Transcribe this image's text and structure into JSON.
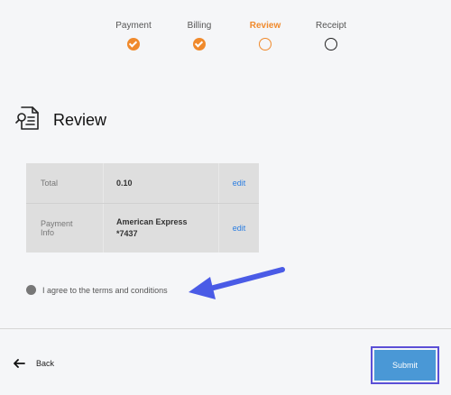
{
  "steps": [
    {
      "label": "Payment",
      "state": "done"
    },
    {
      "label": "Billing",
      "state": "done"
    },
    {
      "label": "Review",
      "state": "current"
    },
    {
      "label": "Receipt",
      "state": "todo"
    }
  ],
  "accent_color": "#f08a2c",
  "link_color": "#2a7de1",
  "header": {
    "icon": "document-search-icon",
    "title": "Review"
  },
  "summary": {
    "rows": [
      {
        "label": "Total",
        "value": "0.10",
        "action": "edit"
      },
      {
        "label": "Payment\nInfo",
        "value": "American Express\n*7437",
        "action": "edit"
      }
    ]
  },
  "terms": {
    "label": "I agree to the terms and conditions",
    "checked": false
  },
  "annotation_arrow_color": "#4a5be6",
  "footer": {
    "back_label": "Back",
    "back_icon": "arrow-left-icon",
    "submit_label": "Submit",
    "submit_color": "#4a98d6"
  }
}
